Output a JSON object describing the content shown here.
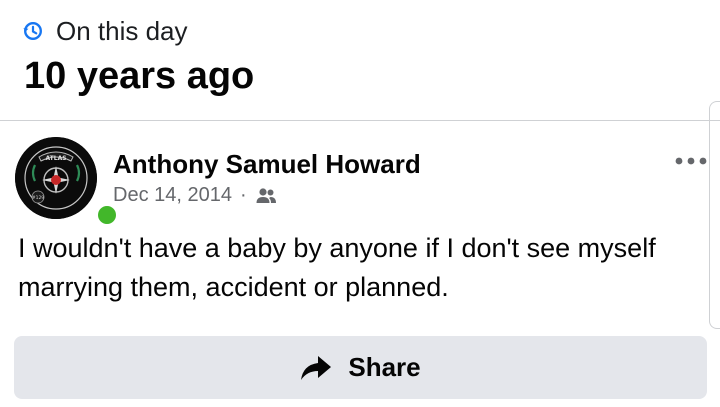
{
  "memories": {
    "on_this_day_label": "On this day",
    "years_ago_label": "10 years ago",
    "icon": "clock-history-icon"
  },
  "post": {
    "author": "Anthony Samuel Howard",
    "date": "Dec 14, 2014",
    "separator": "·",
    "audience_icon": "friends-icon",
    "more_icon": "more-options-icon",
    "online": true,
    "avatar": {
      "emblem_text": "ATLAS",
      "badge_text": "#129"
    },
    "text": "I wouldn't have a baby by anyone if I don't see myself marrying them, accident or planned."
  },
  "actions": {
    "share_label": "Share",
    "share_icon": "share-arrow-icon"
  },
  "colors": {
    "accent_blue": "#1877f2",
    "online_green": "#42b72a",
    "button_bg": "#e4e6eb",
    "secondary_text": "#65676b"
  }
}
